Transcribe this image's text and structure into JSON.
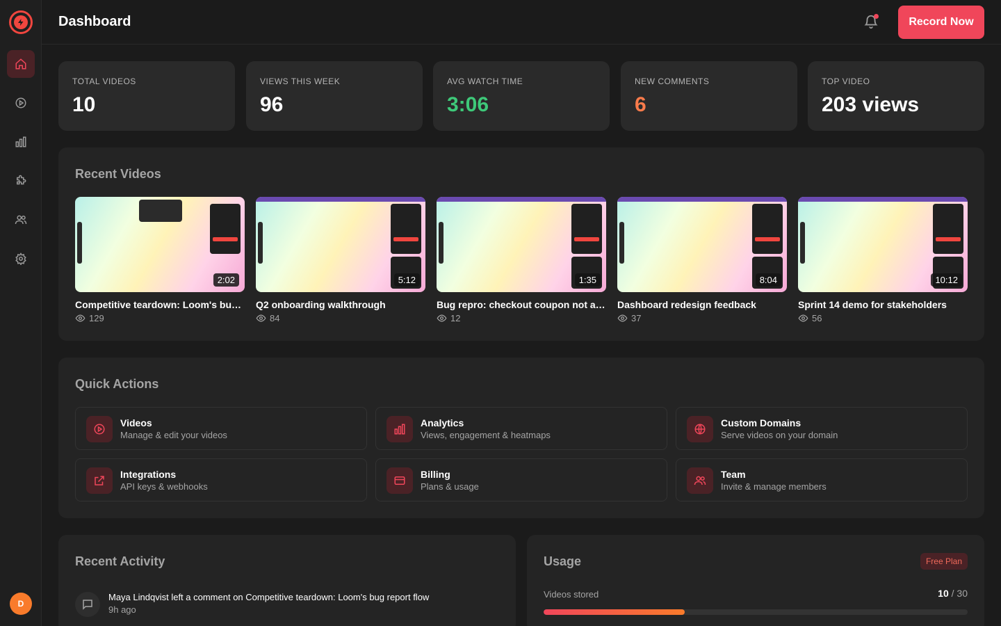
{
  "header": {
    "title": "Dashboard",
    "record_label": "Record Now"
  },
  "user": {
    "avatar_initial": "D"
  },
  "stats": [
    {
      "label": "TOTAL VIDEOS",
      "value": "10",
      "color": "#ffffff"
    },
    {
      "label": "VIEWS THIS WEEK",
      "value": "96",
      "color": "#ffffff"
    },
    {
      "label": "AVG WATCH TIME",
      "value": "3:06",
      "color": "#3ec979"
    },
    {
      "label": "NEW COMMENTS",
      "value": "6",
      "color": "#f97b4b"
    },
    {
      "label": "TOP VIDEO",
      "value": "203 views",
      "color": "#ffffff"
    }
  ],
  "recent_videos": {
    "title": "Recent Videos",
    "items": [
      {
        "title": "Competitive teardown: Loom's bug report flow",
        "duration": "2:02",
        "views": "129"
      },
      {
        "title": "Q2 onboarding walkthrough",
        "duration": "5:12",
        "views": "84"
      },
      {
        "title": "Bug repro: checkout coupon not applying",
        "duration": "1:35",
        "views": "12"
      },
      {
        "title": "Dashboard redesign feedback",
        "duration": "8:04",
        "views": "37"
      },
      {
        "title": "Sprint 14 demo for stakeholders",
        "duration": "10:12",
        "views": "56"
      }
    ]
  },
  "quick_actions": {
    "title": "Quick Actions",
    "items": [
      {
        "title": "Videos",
        "desc": "Manage & edit your videos",
        "icon": "play-icon"
      },
      {
        "title": "Analytics",
        "desc": "Views, engagement & heatmaps",
        "icon": "bar-chart-icon"
      },
      {
        "title": "Custom Domains",
        "desc": "Serve videos on your domain",
        "icon": "globe-icon"
      },
      {
        "title": "Integrations",
        "desc": "API keys & webhooks",
        "icon": "external-link-icon"
      },
      {
        "title": "Billing",
        "desc": "Plans & usage",
        "icon": "credit-card-icon"
      },
      {
        "title": "Team",
        "desc": "Invite & manage members",
        "icon": "users-icon"
      }
    ]
  },
  "activity": {
    "title": "Recent Activity",
    "items": [
      {
        "text": "Maya Lindqvist left a comment on Competitive teardown: Loom's bug report flow",
        "time": "9h ago"
      }
    ]
  },
  "usage": {
    "title": "Usage",
    "plan": "Free Plan",
    "videos_label": "Videos stored",
    "used": "10",
    "limit": "30",
    "separator": "/",
    "fraction_used": 0.333
  },
  "colors": {
    "accent": "#f0465a",
    "accent_bg": "#4a2226",
    "success": "#3ec979",
    "warning": "#f97b4b"
  }
}
